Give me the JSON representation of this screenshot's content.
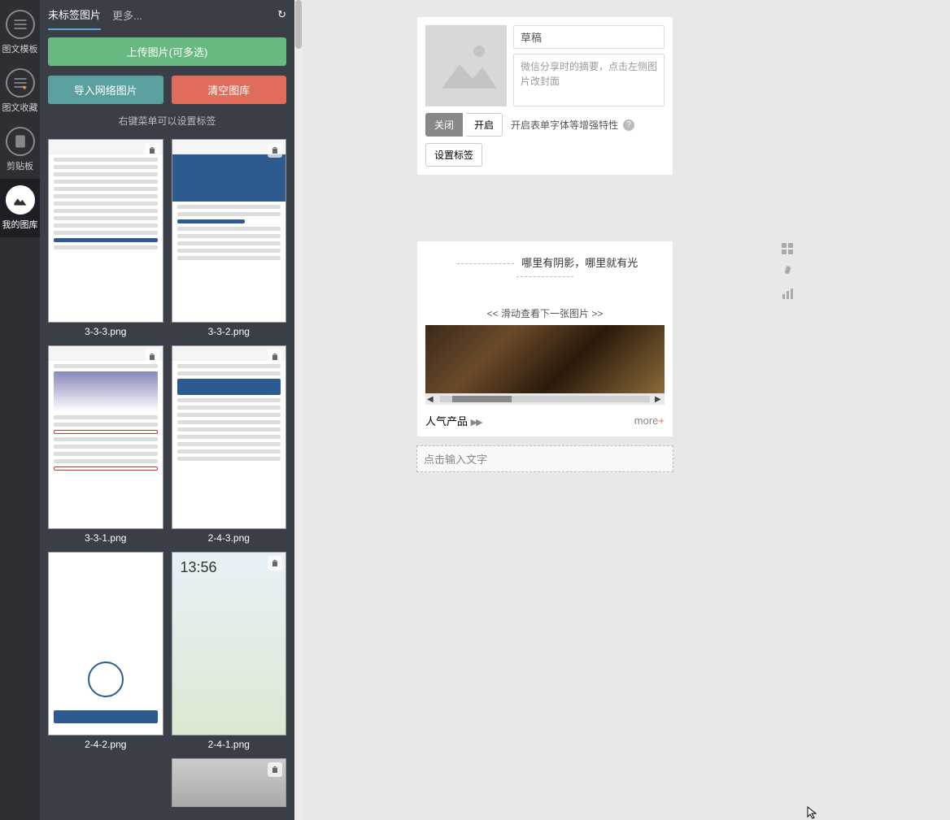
{
  "navRail": [
    {
      "id": "tpl",
      "label": "图文模板"
    },
    {
      "id": "fav",
      "label": "图文收藏"
    },
    {
      "id": "clip",
      "label": "剪贴板"
    },
    {
      "id": "lib",
      "label": "我的图库",
      "active": true
    }
  ],
  "lib": {
    "tabs": [
      {
        "label": "未标签图片",
        "active": true
      },
      {
        "label": "更多..."
      }
    ],
    "uploadBtn": "上传图片(可多选)",
    "importBtn": "导入网络图片",
    "clearBtn": "清空图库",
    "hint": "右键菜单可以设置标签",
    "images": [
      {
        "file": "3-3-3.png"
      },
      {
        "file": "3-3-2.png"
      },
      {
        "file": "3-3-1.png"
      },
      {
        "file": "2-4-3.png"
      },
      {
        "file": "2-4-2.png"
      },
      {
        "file": "2-4-1.png"
      }
    ]
  },
  "meta": {
    "titleValue": "草稿",
    "summaryPlaceholder": "微信分享时的摘要，点击左侧图片改封面",
    "toggleOff": "关闭",
    "toggleOn": "开启",
    "toggleLabel": "开启表单字体等增强特性",
    "tagBtn": "设置标签"
  },
  "content": {
    "ornamentText": "哪里有阴影，哪里就有光",
    "sliderHint": "<< 滑动查看下一张图片 >>",
    "productLabel": "人气产品",
    "moreText": "more",
    "morePlus": "+"
  },
  "insertPlaceholder": "点击输入文字",
  "floatTools": [
    "grid",
    "gear",
    "chart"
  ]
}
